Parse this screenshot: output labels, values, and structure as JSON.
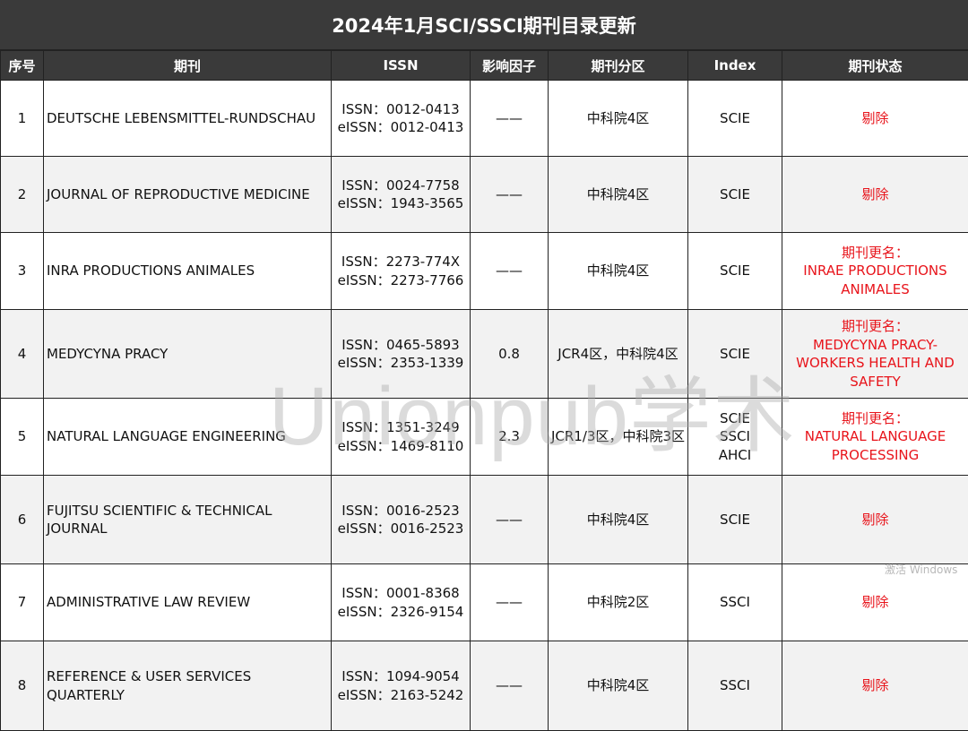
{
  "title": "2024年1月SCI/SSCI期刊目录更新",
  "headers": [
    "序号",
    "期刊",
    "ISSN",
    "影响因子",
    "期刊分区",
    "Index",
    "期刊状态"
  ],
  "rows": [
    {
      "no": "1",
      "name": [
        "DEUTSCHE LEBENSMITTEL-RUNDSCHAU"
      ],
      "issn": [
        "ISSN：0012-0413",
        "eISSN：0012-0413"
      ],
      "if": "——",
      "zone": "中科院4区",
      "index": [
        "SCIE"
      ],
      "status": [
        "剔除"
      ]
    },
    {
      "no": "2",
      "name": [
        "JOURNAL OF REPRODUCTIVE MEDICINE"
      ],
      "issn": [
        "ISSN：0024-7758",
        "eISSN：1943-3565"
      ],
      "if": "——",
      "zone": "中科院4区",
      "index": [
        "SCIE"
      ],
      "status": [
        "剔除"
      ]
    },
    {
      "no": "3",
      "name": [
        "INRA PRODUCTIONS ANIMALES"
      ],
      "issn": [
        "ISSN：2273-774X",
        "eISSN：2273-7766"
      ],
      "if": "——",
      "zone": "中科院4区",
      "index": [
        "SCIE"
      ],
      "status": [
        "期刊更名：",
        "INRAE PRODUCTIONS",
        "ANIMALES"
      ]
    },
    {
      "no": "4",
      "name": [
        "MEDYCYNA PRACY"
      ],
      "issn": [
        "ISSN：0465-5893",
        "eISSN：2353-1339"
      ],
      "if": "0.8",
      "zone": "JCR4区，中科院4区",
      "index": [
        "SCIE"
      ],
      "status": [
        "期刊更名：",
        "MEDYCYNA PRACY-",
        "WORKERS HEALTH AND",
        "SAFETY"
      ]
    },
    {
      "no": "5",
      "name": [
        "NATURAL LANGUAGE ENGINEERING"
      ],
      "issn": [
        "ISSN：1351-3249",
        "eISSN：1469-8110"
      ],
      "if": "2.3",
      "zone": "JCR1/3区，中科院3区",
      "index": [
        "SCIE",
        "SSCI",
        "AHCI"
      ],
      "status": [
        "期刊更名：",
        "NATURAL LANGUAGE",
        "PROCESSING"
      ]
    },
    {
      "no": "6",
      "name": [
        "FUJITSU SCIENTIFIC & TECHNICAL",
        "JOURNAL"
      ],
      "issn": [
        "ISSN：0016-2523",
        "eISSN：0016-2523"
      ],
      "if": "——",
      "zone": "中科院4区",
      "index": [
        "SCIE"
      ],
      "status": [
        "剔除"
      ]
    },
    {
      "no": "7",
      "name": [
        "ADMINISTRATIVE LAW REVIEW"
      ],
      "issn": [
        "ISSN：0001-8368",
        "eISSN：2326-9154"
      ],
      "if": "——",
      "zone": "中科院2区",
      "index": [
        "SSCI"
      ],
      "status": [
        "剔除"
      ]
    },
    {
      "no": "8",
      "name": [
        "REFERENCE & USER SERVICES QUARTERLY"
      ],
      "issn": [
        "ISSN：1094-9054",
        "eISSN：2163-5242"
      ],
      "if": "——",
      "zone": "中科院4区",
      "index": [
        "SSCI"
      ],
      "status": [
        "剔除"
      ]
    }
  ],
  "watermark": "Unionpub学术",
  "activate_text": "激活 Windows"
}
